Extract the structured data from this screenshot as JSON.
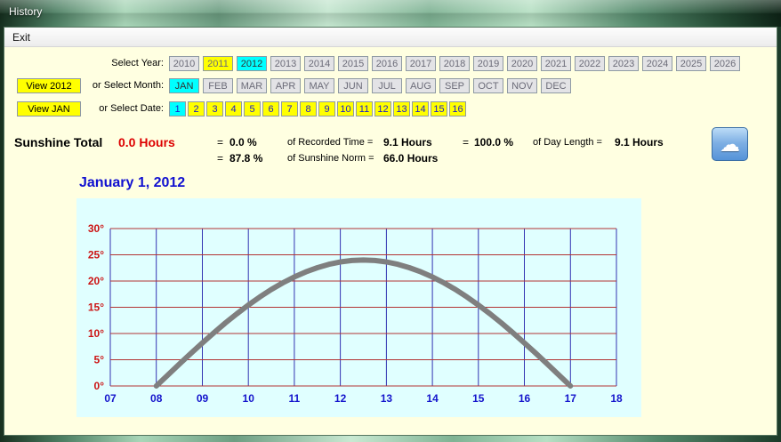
{
  "window": {
    "title": "History"
  },
  "menu": {
    "items": [
      {
        "label": "Exit"
      }
    ]
  },
  "controls": {
    "year": {
      "label": "Select Year:",
      "buttons": [
        {
          "label": "2010",
          "state": "normal"
        },
        {
          "label": "2011",
          "state": "marked"
        },
        {
          "label": "2012",
          "state": "selected"
        },
        {
          "label": "2013",
          "state": "normal"
        },
        {
          "label": "2014",
          "state": "normal"
        },
        {
          "label": "2015",
          "state": "normal"
        },
        {
          "label": "2016",
          "state": "normal"
        },
        {
          "label": "2017",
          "state": "normal"
        },
        {
          "label": "2018",
          "state": "normal"
        },
        {
          "label": "2019",
          "state": "normal"
        },
        {
          "label": "2020",
          "state": "normal"
        },
        {
          "label": "2021",
          "state": "normal"
        },
        {
          "label": "2022",
          "state": "normal"
        },
        {
          "label": "2023",
          "state": "normal"
        },
        {
          "label": "2024",
          "state": "normal"
        },
        {
          "label": "2025",
          "state": "normal"
        },
        {
          "label": "2026",
          "state": "normal"
        }
      ]
    },
    "month": {
      "view_button": "View 2012",
      "label": "or Select Month:",
      "buttons": [
        {
          "label": "JAN",
          "state": "selected"
        },
        {
          "label": "FEB",
          "state": "normal"
        },
        {
          "label": "MAR",
          "state": "normal"
        },
        {
          "label": "APR",
          "state": "normal"
        },
        {
          "label": "MAY",
          "state": "normal"
        },
        {
          "label": "JUN",
          "state": "normal"
        },
        {
          "label": "JUL",
          "state": "normal"
        },
        {
          "label": "AUG",
          "state": "normal"
        },
        {
          "label": "SEP",
          "state": "normal"
        },
        {
          "label": "OCT",
          "state": "normal"
        },
        {
          "label": "NOV",
          "state": "normal"
        },
        {
          "label": "DEC",
          "state": "normal"
        }
      ]
    },
    "date": {
      "view_button": "View JAN",
      "label": "or Select Date:",
      "buttons": [
        {
          "label": "1",
          "state": "selected"
        },
        {
          "label": "2",
          "state": "marked"
        },
        {
          "label": "3",
          "state": "marked"
        },
        {
          "label": "4",
          "state": "marked"
        },
        {
          "label": "5",
          "state": "marked"
        },
        {
          "label": "6",
          "state": "marked"
        },
        {
          "label": "7",
          "state": "marked"
        },
        {
          "label": "8",
          "state": "marked"
        },
        {
          "label": "9",
          "state": "marked"
        },
        {
          "label": "10",
          "state": "marked"
        },
        {
          "label": "11",
          "state": "marked"
        },
        {
          "label": "12",
          "state": "marked"
        },
        {
          "label": "13",
          "state": "marked"
        },
        {
          "label": "14",
          "state": "marked"
        },
        {
          "label": "15",
          "state": "marked"
        },
        {
          "label": "16",
          "state": "marked"
        }
      ]
    }
  },
  "summary": {
    "title": "Sunshine Total",
    "total_value": "0.0 Hours",
    "row1": {
      "eq1": "=",
      "recorded_pct": "0.0 %",
      "recorded_label": "of Recorded Time =",
      "recorded_value": "9.1 Hours",
      "eq2": "=",
      "day_pct": "100.0 %",
      "day_label": "of Day Length =",
      "day_value": "9.1 Hours"
    },
    "row2": {
      "eq": "=",
      "norm_pct": "87.8 %",
      "norm_label": "of Sunshine Norm =",
      "norm_value": "66.0 Hours"
    }
  },
  "weather_button": {
    "icon": "cloud-icon",
    "glyph": "☁"
  },
  "chart_data": {
    "type": "line",
    "title": "January 1, 2012",
    "x_ticks": [
      "07",
      "08",
      "09",
      "10",
      "11",
      "12",
      "13",
      "14",
      "15",
      "16",
      "17",
      "18"
    ],
    "y_ticks": [
      "0°",
      "5°",
      "10°",
      "15°",
      "20°",
      "25°",
      "30°"
    ],
    "xlim": [
      7,
      18
    ],
    "ylim": [
      0,
      30
    ],
    "y_step": 5,
    "grid": true,
    "series": [
      {
        "name": "sun-elevation-degrees",
        "x": [
          8,
          8.25,
          8.5,
          8.75,
          9,
          9.25,
          9.5,
          9.75,
          10,
          10.25,
          10.5,
          10.75,
          11,
          11.25,
          11.5,
          11.75,
          12,
          12.25,
          12.5,
          12.75,
          13,
          13.25,
          13.5,
          13.75,
          14,
          14.25,
          14.5,
          14.75,
          15,
          15.25,
          15.5,
          15.75,
          16,
          16.25,
          16.5,
          16.75,
          17
        ],
        "y": [
          0,
          2.09,
          4.17,
          6.21,
          8.21,
          10.14,
          12,
          13.77,
          15.43,
          16.97,
          18.39,
          19.66,
          20.78,
          21.75,
          22.55,
          23.18,
          23.64,
          23.91,
          24,
          23.91,
          23.64,
          23.18,
          22.55,
          21.75,
          20.78,
          19.66,
          18.39,
          16.97,
          15.43,
          13.77,
          12,
          10.14,
          8.21,
          6.21,
          4.17,
          2.09,
          0
        ]
      }
    ],
    "colors": {
      "curve": "#7f7f7f",
      "h_grid": "#b23333",
      "v_grid": "#3333b2",
      "x_tick": "#1414cc",
      "y_tick": "#cc1414",
      "panel_bg": "#e0ffff"
    }
  }
}
